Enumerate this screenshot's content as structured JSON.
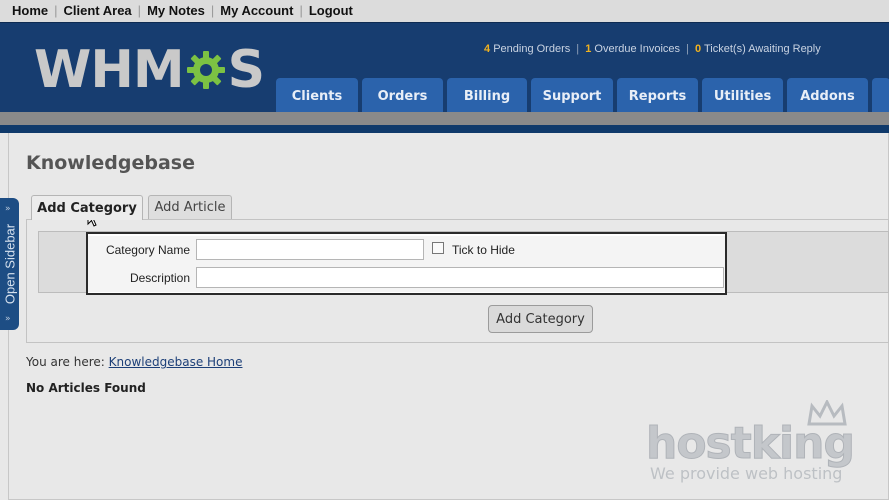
{
  "toplinks": [
    "Home",
    "Client Area",
    "My Notes",
    "My Account",
    "Logout"
  ],
  "logo": {
    "left": "WHM",
    "right": "S"
  },
  "stats": {
    "pending_count": "4",
    "pending_label": "Pending Orders",
    "overdue_count": "1",
    "overdue_label": "Overdue Invoices",
    "tickets_count": "0",
    "tickets_label": "Ticket(s) Awaiting Reply",
    "separator": "|"
  },
  "nav": [
    "Clients",
    "Orders",
    "Billing",
    "Support",
    "Reports",
    "Utilities",
    "Addons"
  ],
  "sidebar": {
    "label": "Open Sidebar",
    "arrow": "»"
  },
  "page": {
    "title": "Knowledgebase"
  },
  "tabs": {
    "add_category": "Add Category",
    "add_article": "Add Article"
  },
  "form": {
    "category_name_label": "Category Name",
    "category_name_value": "",
    "hide_label": "Tick to Hide",
    "hide_checked": false,
    "description_label": "Description",
    "description_value": "",
    "submit_label": "Add Category"
  },
  "breadcrumb": {
    "prefix": "You are here:",
    "link": "Knowledgebase Home"
  },
  "status": {
    "no_articles": "No Articles Found"
  },
  "watermark": {
    "brand": "hostking",
    "tagline": "We provide web hosting"
  },
  "colors": {
    "header": "#173d70",
    "nav_tab": "#2b63ac",
    "accent": "#f0b11f",
    "gear": "#7cc243"
  }
}
